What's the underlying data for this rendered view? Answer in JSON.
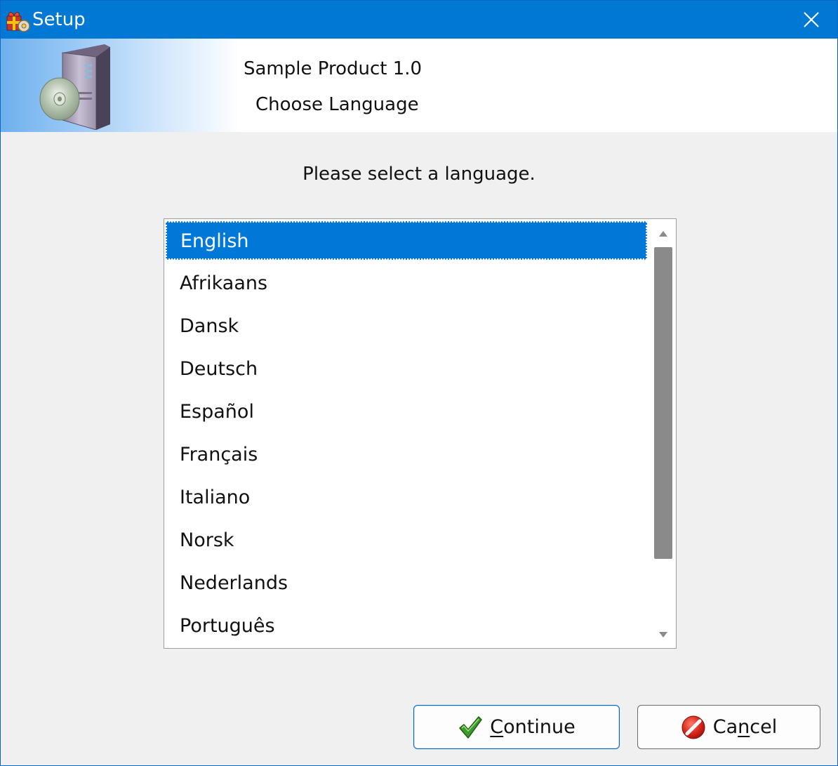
{
  "window": {
    "title": "Setup",
    "close_icon": "close-icon",
    "app_icon": "setup-package-icon"
  },
  "header": {
    "product": "Sample Product 1.0",
    "step": "Choose Language",
    "icon": "software-box-cd-icon"
  },
  "main": {
    "prompt": "Please select a language.",
    "languages": [
      "English",
      "Afrikaans",
      "Dansk",
      "Deutsch",
      "Español",
      "Français",
      "Italiano",
      "Norsk",
      "Nederlands",
      "Português"
    ],
    "selected": "English"
  },
  "buttons": {
    "continue": {
      "mnemonic": "C",
      "rest": "ontinue",
      "icon": "checkmark-icon"
    },
    "cancel": {
      "before": "Ca",
      "mnemonic": "n",
      "rest": "cel",
      "icon": "cancel-icon"
    }
  },
  "colors": {
    "titlebar": "#0078d4",
    "selection": "#0078d7",
    "continue_border": "#0067c0"
  }
}
